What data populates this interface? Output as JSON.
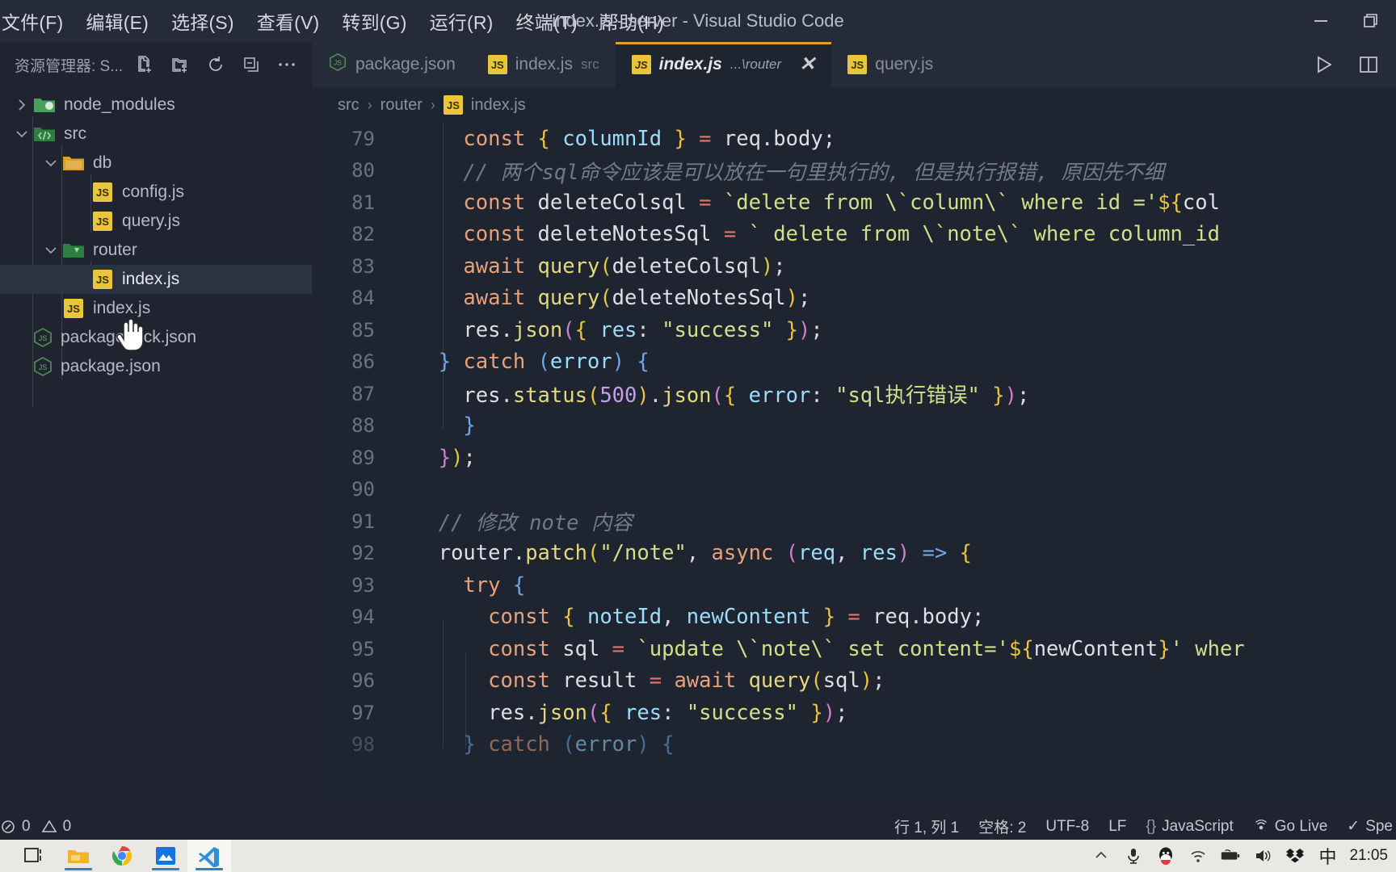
{
  "window": {
    "title": "index.js - server - Visual Studio Code",
    "controls": [
      {
        "name": "minimize-button",
        "glyph": "minimize"
      },
      {
        "name": "restore-button",
        "glyph": "restore"
      }
    ]
  },
  "menubar": {
    "items": [
      {
        "label": "文件(F)"
      },
      {
        "label": "编辑(E)"
      },
      {
        "label": "选择(S)"
      },
      {
        "label": "查看(V)"
      },
      {
        "label": "转到(G)"
      },
      {
        "label": "运行(R)"
      },
      {
        "label": "终端(T)"
      },
      {
        "label": "帮助(H)"
      }
    ]
  },
  "sidebar": {
    "title": "资源管理器: S...",
    "actions": [
      {
        "name": "new-file-icon"
      },
      {
        "name": "new-folder-icon"
      },
      {
        "name": "refresh-icon"
      },
      {
        "name": "collapse-all-icon"
      },
      {
        "name": "more-actions-icon"
      }
    ],
    "tree": [
      {
        "label": "node_modules",
        "type": "folder",
        "indent": 0,
        "expanded": false,
        "icon": "folder-node-modules",
        "selected": false
      },
      {
        "label": "src",
        "type": "folder",
        "indent": 0,
        "expanded": true,
        "icon": "folder-src",
        "selected": false
      },
      {
        "label": "db",
        "type": "folder",
        "indent": 1,
        "expanded": true,
        "icon": "folder-db",
        "selected": false
      },
      {
        "label": "config.js",
        "type": "file",
        "indent": 2,
        "icon": "js-file",
        "selected": false
      },
      {
        "label": "query.js",
        "type": "file",
        "indent": 2,
        "icon": "js-file",
        "selected": false
      },
      {
        "label": "router",
        "type": "folder",
        "indent": 1,
        "expanded": true,
        "icon": "folder-router",
        "selected": false
      },
      {
        "label": "index.js",
        "type": "file",
        "indent": 2,
        "icon": "js-file",
        "selected": true
      },
      {
        "label": "index.js",
        "type": "file",
        "indent": 1,
        "icon": "js-file",
        "selected": false
      },
      {
        "label": "package-lock.json",
        "type": "file",
        "indent": 0,
        "icon": "node-file",
        "selected": false
      },
      {
        "label": "package.json",
        "type": "file",
        "indent": 0,
        "icon": "node-file",
        "selected": false
      }
    ]
  },
  "tabs": {
    "items": [
      {
        "label": "package.json",
        "sub": "",
        "icon": "node-file",
        "active": false,
        "closable": false
      },
      {
        "label": "index.js",
        "sub": "src",
        "icon": "js-file",
        "active": false,
        "closable": false
      },
      {
        "label": "index.js",
        "sub": "...\\router",
        "icon": "js-file",
        "active": true,
        "closable": true
      },
      {
        "label": "query.js",
        "sub": "",
        "icon": "js-file",
        "active": false,
        "closable": false
      }
    ],
    "run_button": "run-icon",
    "split_button": "split-editor-icon"
  },
  "breadcrumb": {
    "parts": [
      "src",
      "router",
      "index.js"
    ],
    "separator": "›"
  },
  "code": {
    "first_line": 79,
    "lines": [
      {
        "num": 79,
        "text": "    const { columnId } = req.body;"
      },
      {
        "num": 80,
        "text": "    // 两个sql命令应该是可以放在一句里执行的, 但是执行报错, 原因先不细"
      },
      {
        "num": 81,
        "text": "    const deleteColsql = `delete from \\`column\\` where id ='${col"
      },
      {
        "num": 82,
        "text": "    const deleteNotesSql = ` delete from \\`note\\` where column_id"
      },
      {
        "num": 83,
        "text": "    await query(deleteColsql);"
      },
      {
        "num": 84,
        "text": "    await query(deleteNotesSql);"
      },
      {
        "num": 85,
        "text": "    res.json({ res: \"success\" });"
      },
      {
        "num": 86,
        "text": "  } catch (error) {"
      },
      {
        "num": 87,
        "text": "    res.status(500).json({ error: \"sql执行错误\" });"
      },
      {
        "num": 88,
        "text": "    }"
      },
      {
        "num": 89,
        "text": "  });"
      },
      {
        "num": 90,
        "text": ""
      },
      {
        "num": 91,
        "text": "  // 修改 note 内容"
      },
      {
        "num": 92,
        "text": "  router.patch(\"/note\", async (req, res) => {"
      },
      {
        "num": 93,
        "text": "    try {"
      },
      {
        "num": 94,
        "text": "      const { noteId, newContent } = req.body;"
      },
      {
        "num": 95,
        "text": "      const sql = `update \\`note\\` set content='${newContent}' wher"
      },
      {
        "num": 96,
        "text": "      const result = await query(sql);"
      },
      {
        "num": 97,
        "text": "      res.json({ res: \"success\" });"
      },
      {
        "num": 98,
        "text": "    } catch (error) {"
      }
    ]
  },
  "statusbar": {
    "problems_errors": "0",
    "problems_warnings": "0",
    "position": "行 1, 列 1",
    "indent": "空格: 2",
    "encoding": "UTF-8",
    "eol": "LF",
    "language": "JavaScript",
    "golive": "Go Live",
    "spell": "Spe"
  },
  "taskbar": {
    "items": [
      {
        "name": "task-view-icon"
      },
      {
        "name": "file-explorer-icon",
        "open": true
      },
      {
        "name": "chrome-icon",
        "open": false
      },
      {
        "name": "blue-app-icon",
        "open": true
      },
      {
        "name": "vscode-icon",
        "open": true,
        "active": true
      }
    ],
    "tray": [
      {
        "name": "show-hidden-icons-chevron"
      },
      {
        "name": "microphone-icon"
      },
      {
        "name": "qq-icon"
      },
      {
        "name": "wifi-icon"
      },
      {
        "name": "battery-icon"
      },
      {
        "name": "volume-icon"
      },
      {
        "name": "dropbox-icon"
      },
      {
        "name": "ime-chinese-icon",
        "label": "中"
      }
    ],
    "clock": "21:05"
  },
  "colors": {
    "accent": "#d6a429",
    "editor_bg": "#1e2430",
    "chrome_bg": "#252b38",
    "taskbar_bg": "#e9e8e4"
  }
}
